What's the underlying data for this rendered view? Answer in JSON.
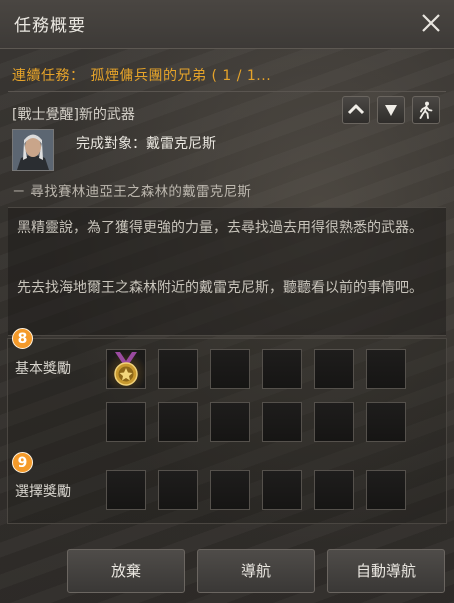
{
  "window": {
    "title": "任務概要"
  },
  "quest": {
    "type_label": "連續任務：",
    "name": "孤煙傭兵團的兄弟 ( 1 / 1..."
  },
  "subquest": {
    "title": "[戰士覺醒]新的武器",
    "target_text": "完成對象：戴雷克尼斯",
    "location": "－ 尋找賽林迪亞王之森林的戴雷克尼斯"
  },
  "description": {
    "para1": "黑精靈說，為了獲得更強的力量，去尋找過去用得很熟悉的武器。",
    "para2": "先去找海地爾王之森林附近的戴雷克尼斯，聽聽看以前的事情吧。"
  },
  "rewards": {
    "basic_marker": "8",
    "basic_label": "基本獎勵",
    "choice_marker": "9",
    "choice_label": "選擇獎勵"
  },
  "buttons": {
    "abandon": "放棄",
    "navigate": "導航",
    "auto_navigate": "自動導航"
  },
  "colors": {
    "accent": "#e5a32a",
    "badge": "#f49a2a"
  },
  "icons": {
    "close": "close-icon",
    "collapse": "chevron-up-icon",
    "expand": "chevron-down-icon",
    "auto_run": "walking-person-icon",
    "reward_item": "medal-icon"
  }
}
